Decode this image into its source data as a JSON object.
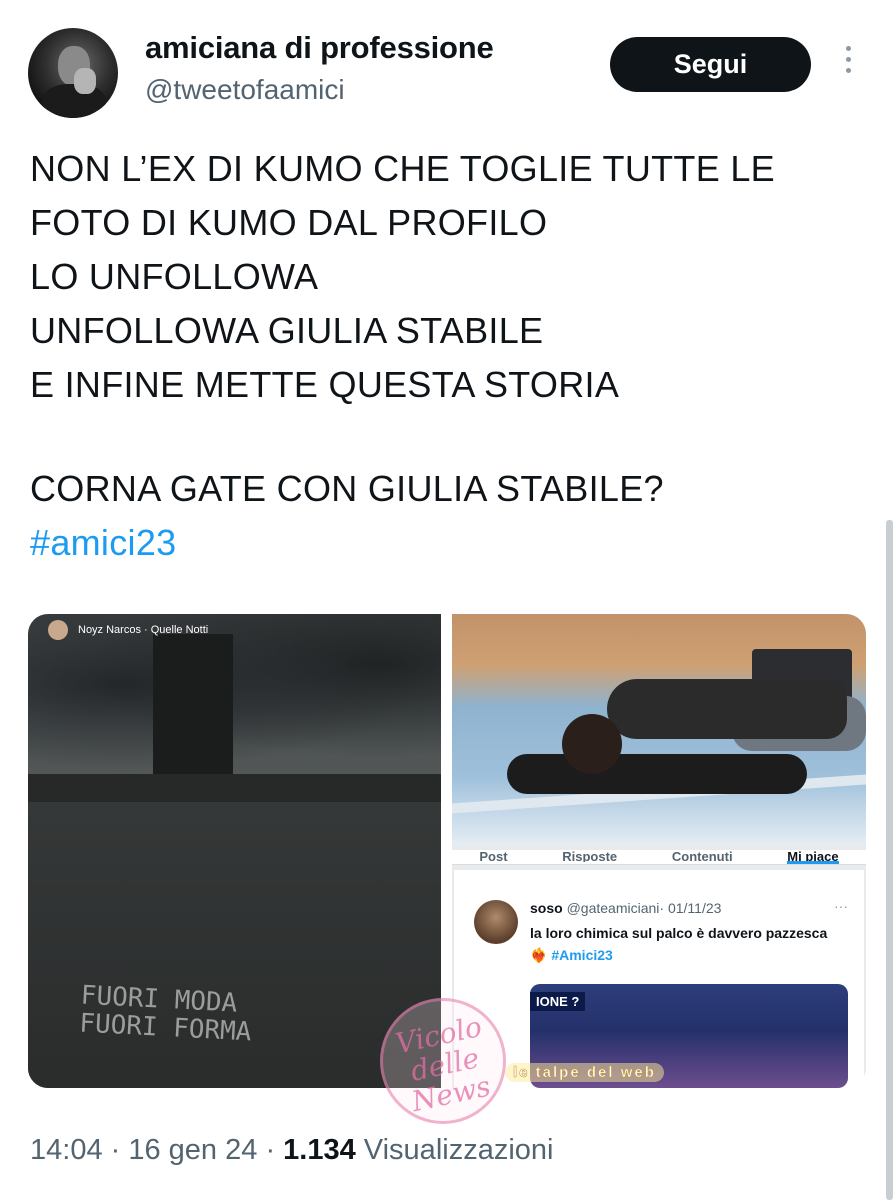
{
  "author": {
    "display_name": "amiciana di professione",
    "handle": "@tweetofaamici"
  },
  "follow_button": {
    "label": "Segui"
  },
  "tweet": {
    "lines": [
      "NON L’EX DI KUMO CHE TOGLIE TUTTE LE",
      "FOTO DI KUMO DAL PROFILO",
      "LO UNFOLLOWA",
      "UNFOLLOWA GIULIA STABILE",
      "E INFINE METTE QUESTA STORIA",
      "CORNA GATE CON GIULIA STABILE?"
    ],
    "hashtag": "#amici23"
  },
  "media": {
    "story": {
      "music_label": "Noyz Narcos · Quelle Notti",
      "graffiti_lines": [
        "FUORI MODA",
        "FUORI FORMA"
      ]
    },
    "profile_tabs": [
      "Post",
      "Risposte",
      "Contenuti",
      "Mi piace"
    ],
    "embedded_tweet": {
      "name": "soso",
      "handle": "@gateamiciani",
      "date": "· 01/11/23",
      "text": "la loro chimica sul palco è davvero pazzesca",
      "emoji": "❤️‍🔥",
      "hashtag": "#Amici23",
      "video_badge": "IONE ?"
    }
  },
  "watermark": {
    "text": "Vicolo delle News",
    "banner": "le talpe del web"
  },
  "meta": {
    "time": "14:04",
    "date": "16 gen 24",
    "views_count": "1.134",
    "views_label": "Visualizzazioni"
  },
  "colors": {
    "link": "#1d9bf0",
    "secondary_text": "#536471",
    "follow_bg": "#0f1419"
  }
}
